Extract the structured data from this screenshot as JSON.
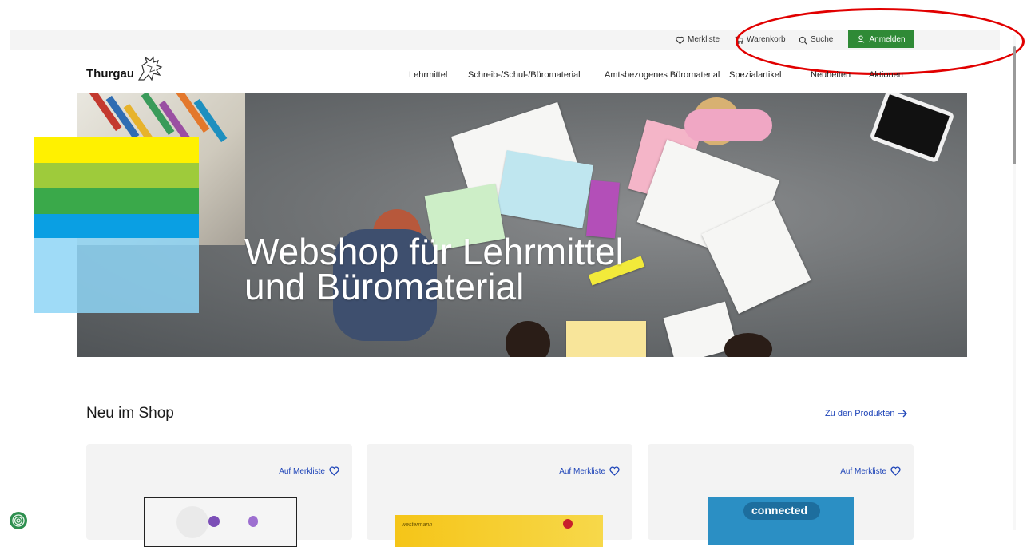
{
  "utility": {
    "wishlist": "Merkliste",
    "cart": "Warenkorb",
    "search": "Suche",
    "login": "Anmelden"
  },
  "header": {
    "logo": "Thurgau",
    "nav": [
      "Lehrmittel",
      "Schreib-/Schul-/Büromaterial",
      "Amtsbezogenes Büromaterial",
      "Spezialartikel",
      "Neuheiten",
      "Aktionen"
    ]
  },
  "hero": {
    "title_line1": "Webshop für Lehrmittel",
    "title_line2": "und Büromaterial"
  },
  "brand_stripes": {
    "colors": [
      "#fff100",
      "#9ecb3b",
      "#3aa94a",
      "#0a9fe3",
      "#8ed5f6"
    ]
  },
  "section": {
    "title": "Neu im Shop",
    "link": "Zu den Produkten",
    "link_icon": "arrow-right-icon"
  },
  "cards": [
    {
      "fav_label": "Auf Merkliste",
      "fav_icon": "heart-icon"
    },
    {
      "fav_label": "Auf Merkliste",
      "fav_icon": "heart-icon",
      "image_text": "westermann"
    },
    {
      "fav_label": "Auf Merkliste",
      "fav_icon": "heart-icon",
      "image_text": "connected"
    }
  ],
  "colors": {
    "accent_green": "#2f8a36",
    "link_blue": "#1f45b8",
    "annotation_red": "#e10000"
  }
}
